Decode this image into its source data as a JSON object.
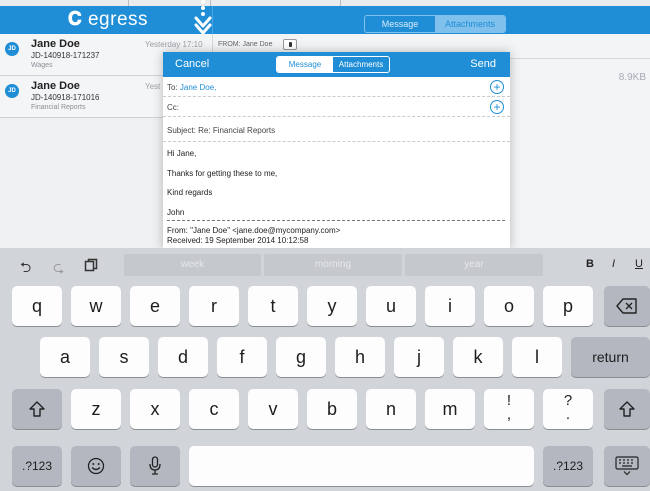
{
  "app": {
    "logo": "egress"
  },
  "background_segment": {
    "message": "Message",
    "attachments": "Attachments"
  },
  "inbox": [
    {
      "avatar": "JD",
      "name": "Jane Doe",
      "id": "JD-140918-171237",
      "subject": "Wages",
      "time": "Yesterday 17:10"
    },
    {
      "avatar": "JD",
      "name": "Jane Doe",
      "id": "JD-140918-171016",
      "subject": "Financial Reports",
      "time": "Yest"
    }
  ],
  "detail": {
    "from_label": "FROM: Jane Doe",
    "size": "8.9KB"
  },
  "compose": {
    "cancel": "Cancel",
    "send": "Send",
    "tab_message": "Message",
    "tab_attachments": "Attachments",
    "to_label": "To:",
    "to_value": "Jane Doe,",
    "cc_label": "Cc:",
    "subject_label": "Subject:",
    "subject_value": "Re: Financial Reports",
    "body": [
      "Hi Jane,",
      "Thanks for getting these to me,",
      "Kind regards",
      "John"
    ],
    "quote_from": "From: \"Jane Doe\" <jane.doe@mycompany.com>",
    "quote_received": "Received: 19 September 2014 10:12:58"
  },
  "keyboard": {
    "suggestions": [
      "week",
      "morning",
      "year"
    ],
    "format": {
      "bold": "B",
      "italic": "I",
      "underline": "U"
    },
    "row1": [
      "q",
      "w",
      "e",
      "r",
      "t",
      "y",
      "u",
      "i",
      "o",
      "p"
    ],
    "row2": [
      "a",
      "s",
      "d",
      "f",
      "g",
      "h",
      "j",
      "k",
      "l"
    ],
    "return": "return",
    "row3": [
      "z",
      "x",
      "c",
      "v",
      "b",
      "n",
      "m"
    ],
    "punct1": {
      "top": "!",
      "bottom": ","
    },
    "punct2": {
      "top": "?",
      "bottom": "."
    },
    "numbers_left": ".?123",
    "numbers_right": ".?123"
  },
  "colors": {
    "brand": "#1f8ed6",
    "keyboard": "#d1d4d9"
  }
}
